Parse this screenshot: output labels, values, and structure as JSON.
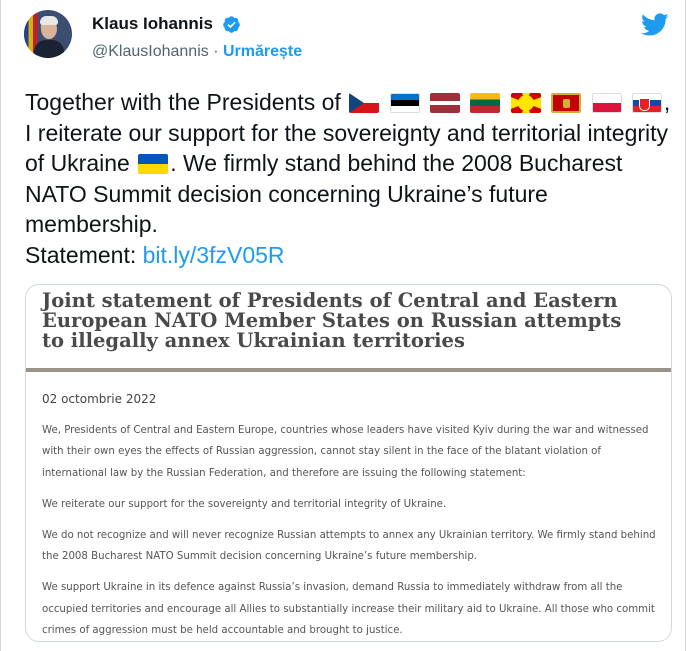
{
  "tweet": {
    "author_name": "Klaus Iohannis",
    "author_handle": "@KlausIohannis",
    "separator": "·",
    "follow_label": "Urmărește",
    "text_part1": "Together with the Presidents of ",
    "text_part2": ", I reiterate our support for the sovereignty and territorial integrity of Ukraine ",
    "text_part3": ". We firmly stand behind the 2008 Bucharest NATO Summit decision concerning Ukraine’s future membership.",
    "statement_label": "Statement: ",
    "link": "bit.ly/3fzV05R",
    "flags": [
      "czech-flag-icon",
      "estonia-flag-icon",
      "latvia-flag-icon",
      "lithuania-flag-icon",
      "north-macedonia-flag-icon",
      "montenegro-flag-icon",
      "poland-flag-icon",
      "slovakia-flag-icon"
    ],
    "ukraine_flag": "ukraine-flag-icon"
  },
  "document": {
    "title": "Joint statement of Presidents of Central and Eastern European NATO Member States on Russian attempts to illegally annex Ukrainian territories",
    "date": "02 octombrie 2022",
    "paragraphs": [
      "We, Presidents of Central and Eastern Europe, countries whose leaders have visited Kyiv during the war and witnessed with their own eyes the effects of Russian aggression, cannot stay silent in the face of the blatant violation of international law by the Russian Federation, and therefore are issuing the following statement:",
      "We reiterate our support for the sovereignty and territorial integrity of Ukraine.",
      "We do not recognize and will never recognize Russian attempts to annex any Ukrainian territory. We firmly stand behind the 2008 Bucharest NATO Summit decision concerning Ukraine’s future membership.",
      "We support Ukraine in its defence against Russia’s invasion, demand Russia to immediately withdraw from all the occupied territories and encourage all Allies to substantially increase their military aid to Ukraine. All those who commit crimes of aggression must be held accountable and brought to justice."
    ]
  },
  "colors": {
    "accent": "#1d9bf0",
    "text": "#0f1419",
    "secondary": "#536471"
  }
}
